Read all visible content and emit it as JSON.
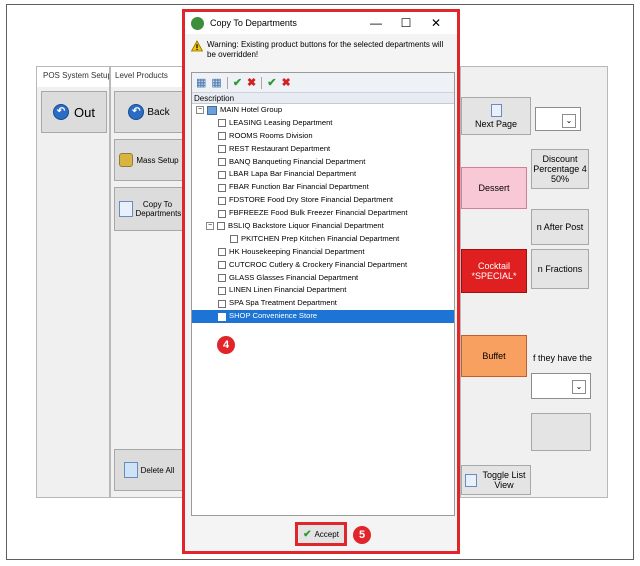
{
  "bg_window1": {
    "title": "POS System Setup",
    "out_label": "Out"
  },
  "bg_window2": {
    "title": "Level Products",
    "back_label": "Back",
    "mass_setup_label": "Mass Setup",
    "copy_to_departments_label": "Copy To Departments",
    "delete_all_label": "Delete All"
  },
  "bg_window3": {
    "next_page_label": "Next Page",
    "discount_label": "Discount Percentage 4 50%",
    "dessert_label": "Dessert",
    "after_post_label": "n After Post",
    "cocktail_label": "Cocktail *SPECIAL*",
    "fractions_label": "n Fractions",
    "buffet_label": "Buffet",
    "if_they_have_label": "f they have the",
    "toggle_list_view_label": "Toggle List View"
  },
  "dialog": {
    "title": "Copy To Departments",
    "warning": "Warning: Existing product buttons for the selected departments will be overridden!",
    "column_header": "Description",
    "accept_label": "Accept",
    "step4": "4",
    "step5": "5",
    "root": "MAIN Hotel Group",
    "items": [
      "LEASING Leasing Department",
      "ROOMS Rooms Division",
      "REST Restaurant Department",
      "BANQ Banqueting Financial Department",
      "LBAR Lapa Bar Financial Department",
      "FBAR Function Bar Financial Department",
      "FDSTORE Food Dry Store Financial Department",
      "FBFREEZE Food Bulk Freezer Financial Department",
      "BSLIQ Backstore Liquor Financial Department",
      "PKITCHEN Prep Kitchen Financial Department",
      "HK Housekeeping Financial Department",
      "CUTCROC Cutlery & Crockery Financial Department",
      "GLASS Glasses Financial Department",
      "LINEN Linen Financial Department",
      "SPA Spa Treatment Department",
      "SHOP Convenience Store"
    ]
  },
  "colors": {
    "highlight_red": "#e0262a",
    "selection_blue": "#1e74d4"
  }
}
